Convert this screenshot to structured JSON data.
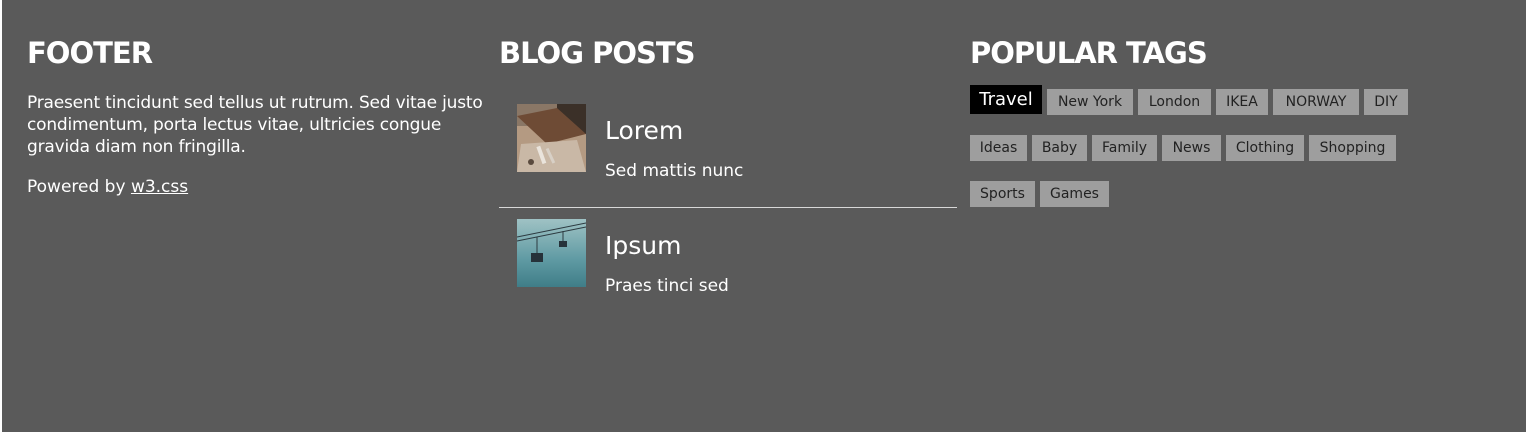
{
  "footer": {
    "heading": "FOOTER",
    "text": "Praesent tincidunt sed tellus ut rutrum. Sed vitae justo condimentum, porta lectus vitae, ultricies congue gravida diam non fringilla.",
    "powered_prefix": "Powered by ",
    "powered_link": "w3.css"
  },
  "blog": {
    "heading": "BLOG POSTS",
    "posts": [
      {
        "title": "Lorem",
        "subtitle": "Sed mattis nunc"
      },
      {
        "title": "Ipsum",
        "subtitle": "Praes tinci sed"
      }
    ]
  },
  "tags": {
    "heading": "POPULAR TAGS",
    "items": [
      "Travel",
      "New York",
      "London",
      "IKEA",
      "NORWAY",
      "DIY",
      "Ideas",
      "Baby",
      "Family",
      "News",
      "Clothing",
      "Shopping",
      "Sports",
      "Games"
    ],
    "active": "Travel"
  },
  "colors": {
    "background": "#5a5a5a",
    "tag": "#9e9e9e",
    "tag_active": "#000000"
  }
}
